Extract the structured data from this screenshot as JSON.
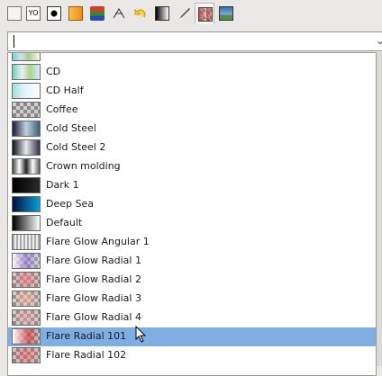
{
  "toolbar": {
    "tabs": [
      {
        "icon": "layers-icon"
      },
      {
        "icon": "tool-options-icon"
      },
      {
        "icon": "device-status-icon"
      },
      {
        "icon": "patterns-icon"
      },
      {
        "icon": "palettes-icon"
      },
      {
        "icon": "paths-icon"
      },
      {
        "icon": "undo-history-icon"
      },
      {
        "icon": "gradient-editor-icon"
      },
      {
        "icon": "brushes-icon"
      },
      {
        "icon": "gradients-icon"
      },
      {
        "icon": "images-icon"
      }
    ]
  },
  "search": {
    "value": "",
    "dropdown": "⌄"
  },
  "gradients": [
    {
      "name": "CD"
    },
    {
      "name": "CD Half"
    },
    {
      "name": "Coffee"
    },
    {
      "name": "Cold Steel"
    },
    {
      "name": "Cold Steel 2"
    },
    {
      "name": "Crown molding"
    },
    {
      "name": "Dark 1"
    },
    {
      "name": "Deep Sea"
    },
    {
      "name": "Default"
    },
    {
      "name": "Flare Glow Angular 1"
    },
    {
      "name": "Flare Glow Radial 1"
    },
    {
      "name": "Flare Glow Radial 2"
    },
    {
      "name": "Flare Glow Radial 3"
    },
    {
      "name": "Flare Glow Radial 4"
    },
    {
      "name": "Flare Radial 101",
      "selected": true
    },
    {
      "name": "Flare Radial 102"
    }
  ],
  "colors": {
    "selection": "#7eaee3"
  }
}
